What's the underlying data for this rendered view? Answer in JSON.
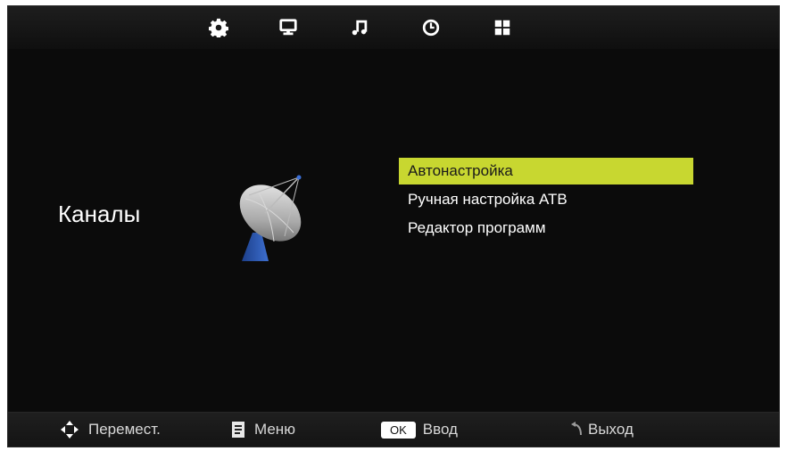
{
  "tabs": [
    {
      "icon": "gear-icon",
      "label": ""
    },
    {
      "icon": "monitor-icon",
      "label": ""
    },
    {
      "icon": "music-note-icon",
      "label": ""
    },
    {
      "icon": "clock-icon",
      "label": ""
    },
    {
      "icon": "grid-icon",
      "label": ""
    }
  ],
  "section": {
    "title": "Каналы",
    "icon": "satellite-dish-icon"
  },
  "menu": {
    "selected_index": 0,
    "highlight_color": "#c8d730",
    "items": [
      {
        "label": "Автонастройка"
      },
      {
        "label": "Ручная настройка АТВ"
      },
      {
        "label": "Редактор программ"
      }
    ]
  },
  "footer": {
    "move": {
      "icon": "directional-pad-icon",
      "label": "Перемест."
    },
    "menu": {
      "icon": "menu-icon",
      "label": "Меню"
    },
    "enter": {
      "key": "OK",
      "label": "Ввод"
    },
    "exit": {
      "icon": "return-icon",
      "label": "Выход"
    }
  }
}
